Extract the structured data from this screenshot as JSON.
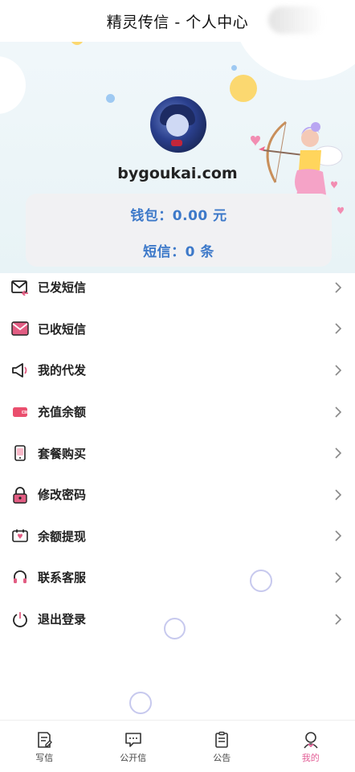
{
  "header": {
    "title": "精灵传信 - 个人中心"
  },
  "profile": {
    "username": "bygoukai.com",
    "wallet_text": "钱包：0.00 元",
    "sms_text": "短信：0 条"
  },
  "menu": [
    {
      "label": "已发短信",
      "icon": "sent-mail-icon"
    },
    {
      "label": "已收短信",
      "icon": "received-mail-icon"
    },
    {
      "label": "我的代发",
      "icon": "megaphone-icon"
    },
    {
      "label": "充值余额",
      "icon": "wallet-icon"
    },
    {
      "label": "套餐购买",
      "icon": "phone-package-icon"
    },
    {
      "label": "修改密码",
      "icon": "lock-icon"
    },
    {
      "label": "余额提现",
      "icon": "withdraw-icon"
    },
    {
      "label": "联系客服",
      "icon": "headset-icon"
    },
    {
      "label": "退出登录",
      "icon": "power-icon"
    }
  ],
  "tabs": [
    {
      "label": "写信",
      "icon": "write-icon",
      "active": false
    },
    {
      "label": "公开信",
      "icon": "public-letter-icon",
      "active": false
    },
    {
      "label": "公告",
      "icon": "notice-icon",
      "active": false
    },
    {
      "label": "我的",
      "icon": "profile-icon",
      "active": true
    }
  ],
  "colors": {
    "accent_blue": "#3d79c9",
    "accent_pink": "#e25d95",
    "icon_dark": "#222222",
    "icon_pink": "#e25d83"
  }
}
